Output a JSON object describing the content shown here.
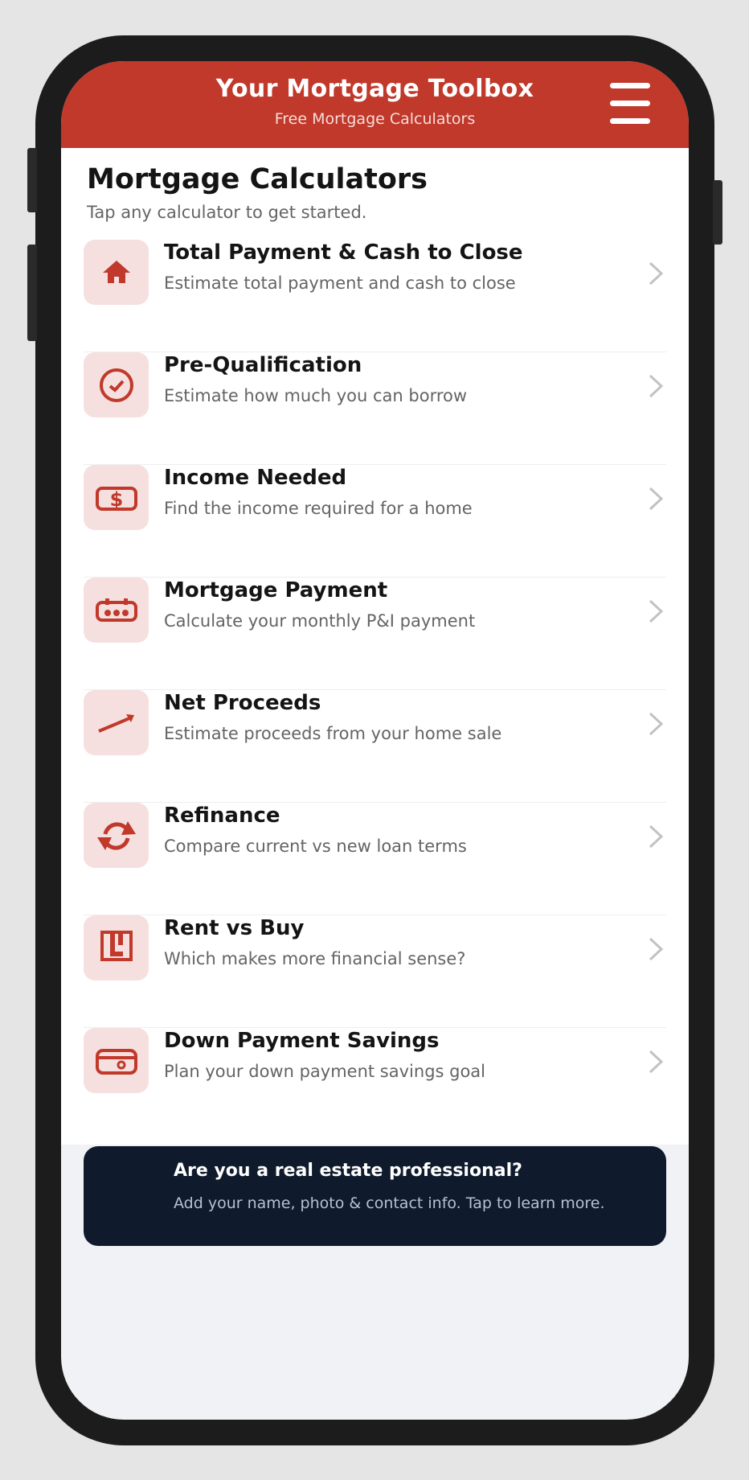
{
  "header": {
    "title": "Your Mortgage Toolbox",
    "subtitle": "Free Mortgage Calculators",
    "menu_icon": "hamburger-menu-icon"
  },
  "section": {
    "title": "Mortgage Calculators",
    "subtitle": "Tap any calculator to get started."
  },
  "calculators": [
    {
      "title": "Total Payment & Cash to Close",
      "description": "Estimate total payment and cash to close",
      "icon": "house-icon"
    },
    {
      "title": "Pre-Qualification",
      "description": "Estimate how much you can borrow",
      "icon": "check-circle-icon"
    },
    {
      "title": "Income Needed",
      "description": "Find the income required for a home",
      "icon": "dollar-bill-icon"
    },
    {
      "title": "Mortgage Payment",
      "description": "Calculate your monthly P&I payment",
      "icon": "calendar-payment-icon"
    },
    {
      "title": "Net Proceeds",
      "description": "Estimate proceeds from your home sale",
      "icon": "trending-up-icon"
    },
    {
      "title": "Refinance",
      "description": "Compare current vs new loan terms",
      "icon": "refresh-icon"
    },
    {
      "title": "Rent vs Buy",
      "description": "Which makes more financial sense?",
      "icon": "building-icon"
    },
    {
      "title": "Down Payment Savings",
      "description": "Plan your down payment savings goal",
      "icon": "wallet-icon"
    }
  ],
  "banner": {
    "title": "Are you a real estate professional?",
    "description": "Add your name, photo & contact info. Tap to learn more."
  },
  "colors": {
    "brand": "#c0392b",
    "icon_bg": "#f5e0df",
    "banner_bg": "#0f1b2d"
  }
}
